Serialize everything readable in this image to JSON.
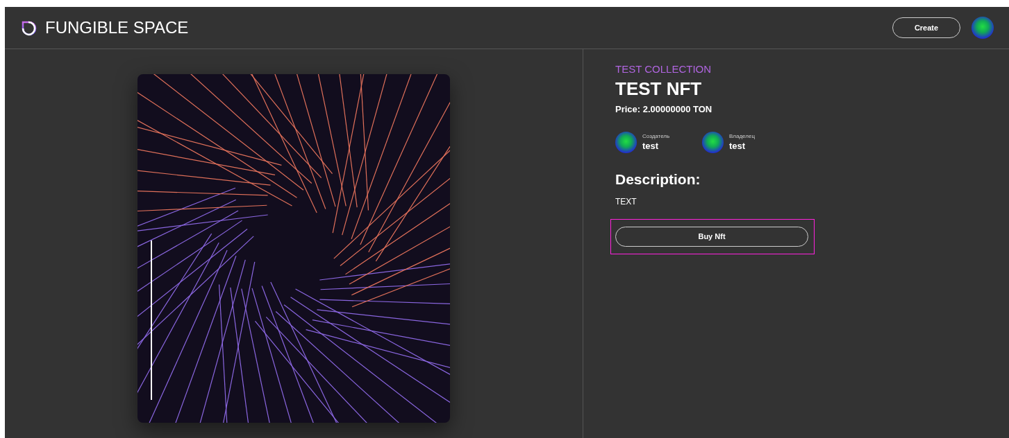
{
  "header": {
    "brand": "FUNGIBLE SPACE",
    "create_button": "Create"
  },
  "nft": {
    "collection": "TEST COLLECTION",
    "title": "TEST NFT",
    "price": "Price: 2.00000000 TON",
    "people": [
      {
        "role": "Создатель",
        "name": "test"
      },
      {
        "role": "Владелец",
        "name": "test"
      }
    ],
    "description_heading": "Description:",
    "description": "TEXT",
    "buy_button": "Buy Nft",
    "buy_highlighted": true
  }
}
